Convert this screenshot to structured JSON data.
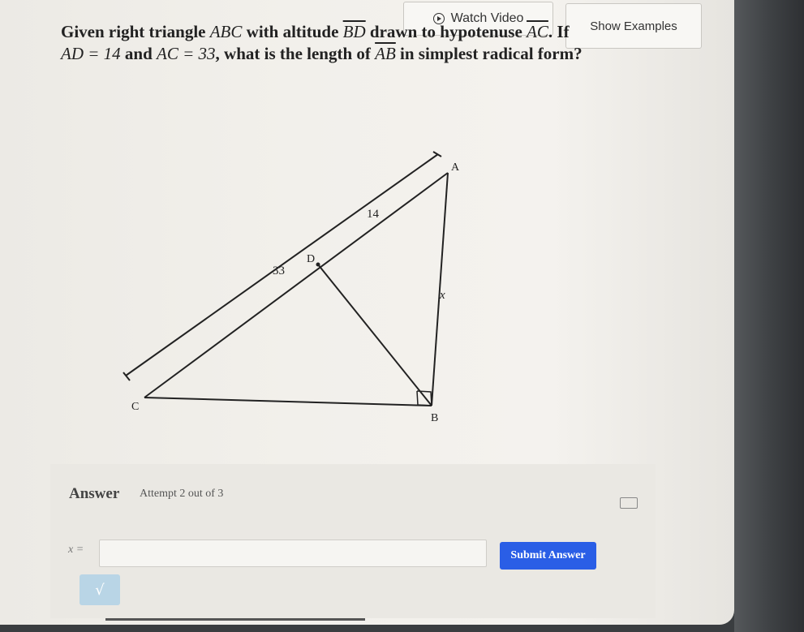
{
  "header": {
    "watch_video_label": "Watch Video",
    "show_examples_label": "Show Examples"
  },
  "question": {
    "part1": "Given right triangle ",
    "abc": "ABC",
    "part2": " with altitude ",
    "bd": "BD",
    "part3": " drawn to hypotenuse ",
    "ac": "AC",
    "part4": ". If",
    "ad_eq": "AD = 14",
    "part5": " and ",
    "ac_eq": "AC = 33",
    "part6": ", what is the length of ",
    "ab": "AB",
    "part7": " in simplest radical form?"
  },
  "diagram": {
    "labels": {
      "A": "A",
      "B": "B",
      "C": "C",
      "D": "D",
      "x": "x"
    },
    "len_ad": "14",
    "len_ac": "33"
  },
  "answer": {
    "label": "Answer",
    "attempt": "Attempt 2 out of 3",
    "var_label": "x =",
    "input_value": "",
    "submit_label": "Submit Answer",
    "sqrt_label": "√"
  }
}
